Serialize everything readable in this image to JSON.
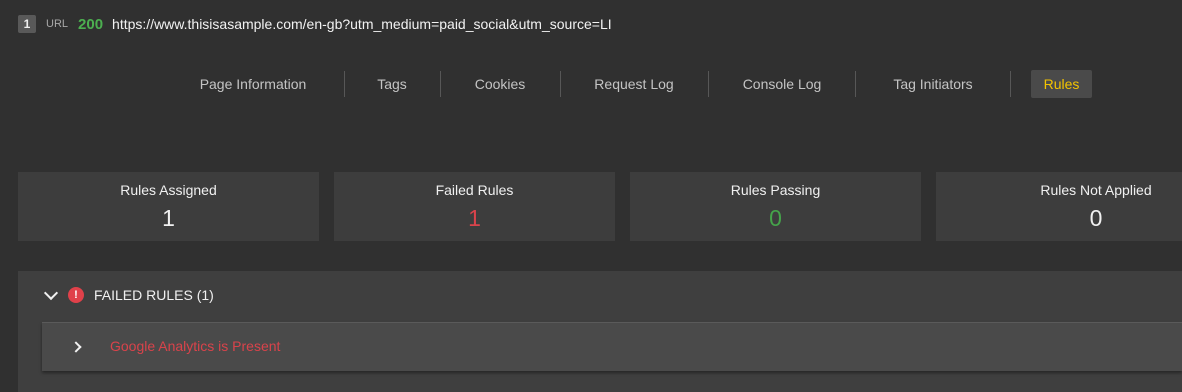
{
  "url_bar": {
    "index": "1",
    "label": "URL",
    "status": "200",
    "url": "https://www.thisisasample.com/en-gb?utm_medium=paid_social&utm_source=LI"
  },
  "tabs": [
    {
      "label": "Page Information",
      "active": false
    },
    {
      "label": "Tags",
      "active": false
    },
    {
      "label": "Cookies",
      "active": false
    },
    {
      "label": "Request Log",
      "active": false
    },
    {
      "label": "Console Log",
      "active": false
    },
    {
      "label": "Tag Initiators",
      "active": false
    },
    {
      "label": "Rules",
      "active": true
    }
  ],
  "stats": [
    {
      "title": "Rules Assigned",
      "value": "1"
    },
    {
      "title": "Failed Rules",
      "value": "1"
    },
    {
      "title": "Rules Passing",
      "value": "0"
    },
    {
      "title": "Rules Not Applied",
      "value": "0"
    }
  ],
  "failed_panel": {
    "title": "FAILED RULES (1)",
    "alert_symbol": "!",
    "rules": [
      {
        "name": "Google Analytics is Present"
      }
    ]
  },
  "colors": {
    "status_ok": "#4caf50",
    "active_tab": "#f4c400",
    "failed": "#d9434b",
    "passing": "#45a34a"
  }
}
